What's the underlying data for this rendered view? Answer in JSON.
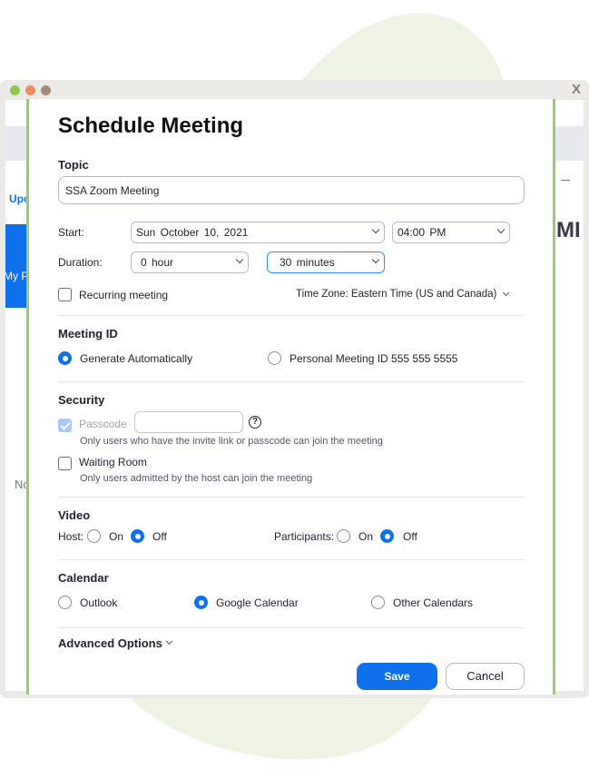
{
  "window": {
    "close_label": "X",
    "traffic_colors": [
      "#8cc84b",
      "#f08a5d",
      "#a58b7a"
    ]
  },
  "background_app": {
    "tab_label": "Upc",
    "blue_item_label": "My Pe",
    "empty_text": "No",
    "heading_fragment": "MI"
  },
  "dialog": {
    "title": "Schedule Meeting",
    "topic": {
      "label": "Topic",
      "value": "SSA Zoom Meeting"
    },
    "start": {
      "label": "Start:",
      "date": "Sun October 10, 2021",
      "time": "04:00 PM"
    },
    "duration": {
      "label": "Duration:",
      "hours": "0 hour",
      "minutes": "30 minutes"
    },
    "recurring": {
      "label": "Recurring meeting",
      "checked": false
    },
    "timezone": "Time Zone: Eastern Time (US and Canada)",
    "meeting_id": {
      "label": "Meeting ID",
      "generate": "Generate Automatically",
      "personal": "Personal Meeting ID 555 555 5555",
      "selected": "generate"
    },
    "security": {
      "label": "Security",
      "passcode_label": "Passcode",
      "passcode_value": "",
      "passcode_hint": "Only users who have the invite link or passcode can join the meeting",
      "waiting_room_label": "Waiting Room",
      "waiting_room_hint": "Only users admitted by the host can join the meeting",
      "help_glyph": "?"
    },
    "video": {
      "label": "Video",
      "host_label": "Host:",
      "participants_label": "Participants:",
      "on_label": "On",
      "off_label": "Off",
      "host": "off",
      "participants": "off"
    },
    "calendar": {
      "label": "Calendar",
      "outlook": "Outlook",
      "google": "Google Calendar",
      "other": "Other Calendars",
      "selected": "google"
    },
    "advanced_label": "Advanced Options",
    "save_label": "Save",
    "cancel_label": "Cancel"
  },
  "colors": {
    "accent": "#0e71eb",
    "frame_border": "#9dc977",
    "window_bg": "#eceae6"
  }
}
